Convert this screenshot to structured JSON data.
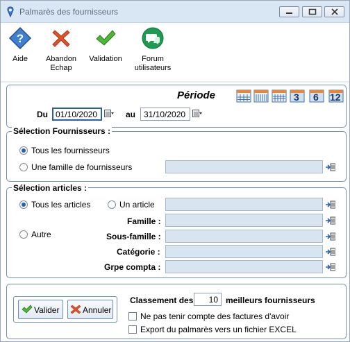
{
  "window": {
    "title": "Palmarès des fournisseurs"
  },
  "toolbar": {
    "aide": "Aide",
    "abandon_line1": "Abandon",
    "abandon_line2": "Echap",
    "validation": "Validation",
    "forum_line1": "Forum",
    "forum_line2": "utilisateurs"
  },
  "periode": {
    "title": "Période",
    "du_label": "Du",
    "du_value": "01/10/2020",
    "au_label": "au",
    "au_value": "31/10/2020",
    "shortcut_buttons": [
      "3",
      "6",
      "12"
    ]
  },
  "fournisseurs": {
    "title": "Sélection Fournisseurs :",
    "option_all": "Tous les fournisseurs",
    "option_family": "Une famille de fournisseurs",
    "selected": "all"
  },
  "articles": {
    "title": "Sélection articles :",
    "option_all": "Tous les articles",
    "option_one": "Un article",
    "option_other": "Autre",
    "famille_label": "Famille :",
    "sous_famille_label": "Sous-famille :",
    "categorie_label": "Catégorie :",
    "compta_label": "Grpe compta :",
    "selected": "all"
  },
  "bottom": {
    "valider": "Valider",
    "annuler": "Annuler",
    "classement_prefix": "Classement des",
    "classement_value": "10",
    "classement_suffix": "meilleurs fournisseurs",
    "check_avoir": "Ne pas tenir compte des factures d'avoir",
    "check_export": "Export du palmarès vers un fichier EXCEL"
  },
  "colors": {
    "accent": "#1f5fbf",
    "border": "#6d8fb8",
    "field": "#d8e4f0"
  }
}
